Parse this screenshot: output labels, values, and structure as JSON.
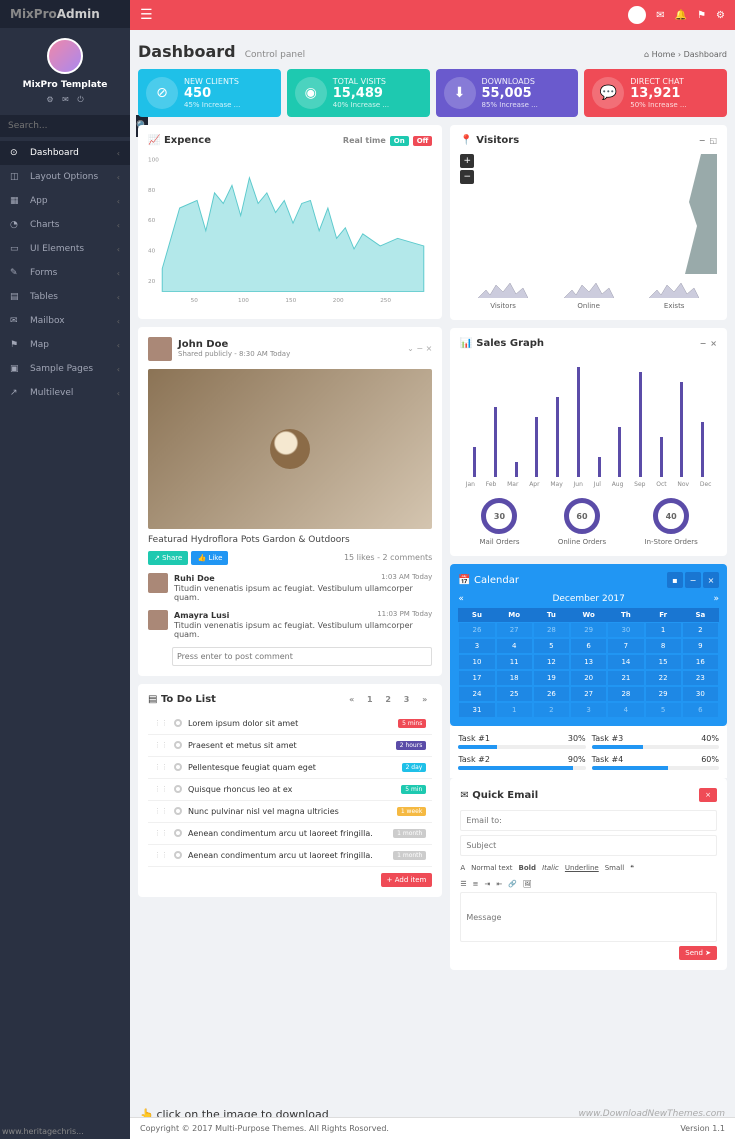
{
  "brand": {
    "pre": "MixPro",
    "post": "Admin"
  },
  "profile": {
    "name": "MixPro Template"
  },
  "search": {
    "placeholder": "Search..."
  },
  "nav": [
    {
      "icon": "⊙",
      "label": "Dashboard",
      "active": true
    },
    {
      "icon": "◫",
      "label": "Layout Options"
    },
    {
      "icon": "▦",
      "label": "App"
    },
    {
      "icon": "◔",
      "label": "Charts"
    },
    {
      "icon": "▭",
      "label": "UI Elements"
    },
    {
      "icon": "✎",
      "label": "Forms"
    },
    {
      "icon": "▤",
      "label": "Tables"
    },
    {
      "icon": "✉",
      "label": "Mailbox"
    },
    {
      "icon": "⚑",
      "label": "Map"
    },
    {
      "icon": "▣",
      "label": "Sample Pages"
    },
    {
      "icon": "↗",
      "label": "Multilevel"
    }
  ],
  "page": {
    "title": "Dashboard",
    "subtitle": "Control panel"
  },
  "breadcrumb": {
    "home": "Home",
    "current": "Dashboard"
  },
  "stats": [
    {
      "color": "#1fc0e8",
      "icon": "⊘",
      "label": "NEW CLIENTS",
      "value": "450",
      "sub": "45% Increase ..."
    },
    {
      "color": "#1ec9b0",
      "icon": "◉",
      "label": "TOTAL VISITS",
      "value": "15,489",
      "sub": "40% Increase ..."
    },
    {
      "color": "#6a5acd",
      "icon": "⬇",
      "label": "DOWNLOADS",
      "value": "55,005",
      "sub": "85% Increase ..."
    },
    {
      "color": "#ef4b56",
      "icon": "💬",
      "label": "DIRECT CHAT",
      "value": "13,921",
      "sub": "50% Increase ..."
    }
  ],
  "expense": {
    "title": "Expence",
    "realtime": "Real time",
    "on": "On",
    "off": "Off"
  },
  "chart_data": [
    {
      "type": "area",
      "title": "Expence",
      "xlabel": "",
      "ylabel": "",
      "xlim": [
        0,
        300
      ],
      "ylim": [
        20,
        100
      ],
      "x": [
        0,
        20,
        40,
        50,
        60,
        70,
        80,
        90,
        100,
        110,
        120,
        130,
        140,
        150,
        160,
        170,
        180,
        190,
        200,
        210,
        220,
        230,
        250,
        270,
        300
      ],
      "values": [
        35,
        75,
        80,
        60,
        85,
        78,
        90,
        70,
        95,
        78,
        85,
        72,
        80,
        65,
        78,
        80,
        60,
        75,
        55,
        62,
        48,
        58,
        50,
        55,
        50
      ]
    },
    {
      "type": "bar",
      "title": "Sales Graph",
      "categories": [
        "Jan",
        "Feb",
        "Mar",
        "Apr",
        "May",
        "Jun",
        "Jul",
        "Aug",
        "Sep",
        "Oct",
        "Nov",
        "Dec"
      ],
      "values": [
        30,
        70,
        15,
        60,
        80,
        110,
        20,
        50,
        105,
        40,
        95,
        55
      ],
      "ylim": [
        0,
        120
      ]
    }
  ],
  "visitors": {
    "title": "Visitors",
    "sparks": [
      "Visitors",
      "Online",
      "Exists"
    ]
  },
  "post": {
    "author": "John Doe",
    "meta": "Shared publicly - 8:30 AM Today",
    "caption": "Featurad Hydroflora Pots Gardon & Outdoors",
    "share": "Share",
    "like": "Like",
    "stats": "15 likes - 2 comments",
    "comments": [
      {
        "name": "Ruhi Doe",
        "time": "1:03 AM Today",
        "text": "Titudin venenatis ipsum ac feugiat. Vestibulum ullamcorper quam."
      },
      {
        "name": "Amayra Lusi",
        "time": "11:03 PM Today",
        "text": "Titudin venenatis ipsum ac feugiat. Vestibulum ullamcorper quam."
      }
    ],
    "placeholder": "Press enter to post comment"
  },
  "sales": {
    "title": "Sales Graph",
    "donuts": [
      {
        "value": "30",
        "label": "Mail Orders"
      },
      {
        "value": "60",
        "label": "Online Orders"
      },
      {
        "value": "40",
        "label": "In-Store Orders"
      }
    ]
  },
  "calendar": {
    "title": "Calendar",
    "month": "December 2017",
    "dows": [
      "Su",
      "Mo",
      "Tu",
      "Wo",
      "Th",
      "Fr",
      "Sa"
    ],
    "prefill": [
      "26",
      "27",
      "28",
      "29",
      "30"
    ],
    "days": [
      "1",
      "2",
      "3",
      "4",
      "5",
      "6",
      "7",
      "8",
      "9",
      "10",
      "11",
      "12",
      "13",
      "14",
      "15",
      "16",
      "17",
      "18",
      "19",
      "20",
      "21",
      "22",
      "23",
      "24",
      "25",
      "26",
      "27",
      "28",
      "29",
      "30",
      "31"
    ],
    "postfill": [
      "1",
      "2",
      "3",
      "4",
      "5",
      "6"
    ]
  },
  "tasks": [
    {
      "name": "Task #1",
      "pct": 30
    },
    {
      "name": "Task #3",
      "pct": 40
    },
    {
      "name": "Task #2",
      "pct": 90
    },
    {
      "name": "Task #4",
      "pct": 60
    }
  ],
  "todo": {
    "title": "To Do List",
    "add": "+ Add item",
    "items": [
      {
        "text": "Lorem ipsum dolor sit amet",
        "tag": "5 mins",
        "color": "#ef4b56"
      },
      {
        "text": "Praesent et metus sit amet",
        "tag": "2 hours",
        "color": "#5b4ca8"
      },
      {
        "text": "Pellentesque feugiat quam eget",
        "tag": "2 day",
        "color": "#1fc0e8"
      },
      {
        "text": "Quisque rhoncus leo at ex",
        "tag": "5 min",
        "color": "#1ec9b0"
      },
      {
        "text": "Nunc pulvinar nisl vel magna ultricies",
        "tag": "1 week",
        "color": "#f5b942"
      },
      {
        "text": "Aenean condimentum arcu ut laoreet fringilla.",
        "tag": "1 month",
        "color": "#ccc"
      },
      {
        "text": "Aenean condimentum arcu ut laoreet fringilla.",
        "tag": "1 month",
        "color": "#ccc"
      }
    ]
  },
  "email": {
    "title": "Quick Email",
    "to": "Email to:",
    "subject": "Subject",
    "normal": "Normal text",
    "bold": "Bold",
    "italic": "Italic",
    "underline": "Underline",
    "small": "Small",
    "message": "Message",
    "send": "Send"
  },
  "footer": {
    "copy": "Copyright © 2017 Multi-Purpose Themes. All Rights Rosorved.",
    "version": "Version 1.1"
  },
  "watermark": "www.DownloadNewThemes.com",
  "hint": "click on the image to download",
  "heritage": "www.heritagechris..."
}
